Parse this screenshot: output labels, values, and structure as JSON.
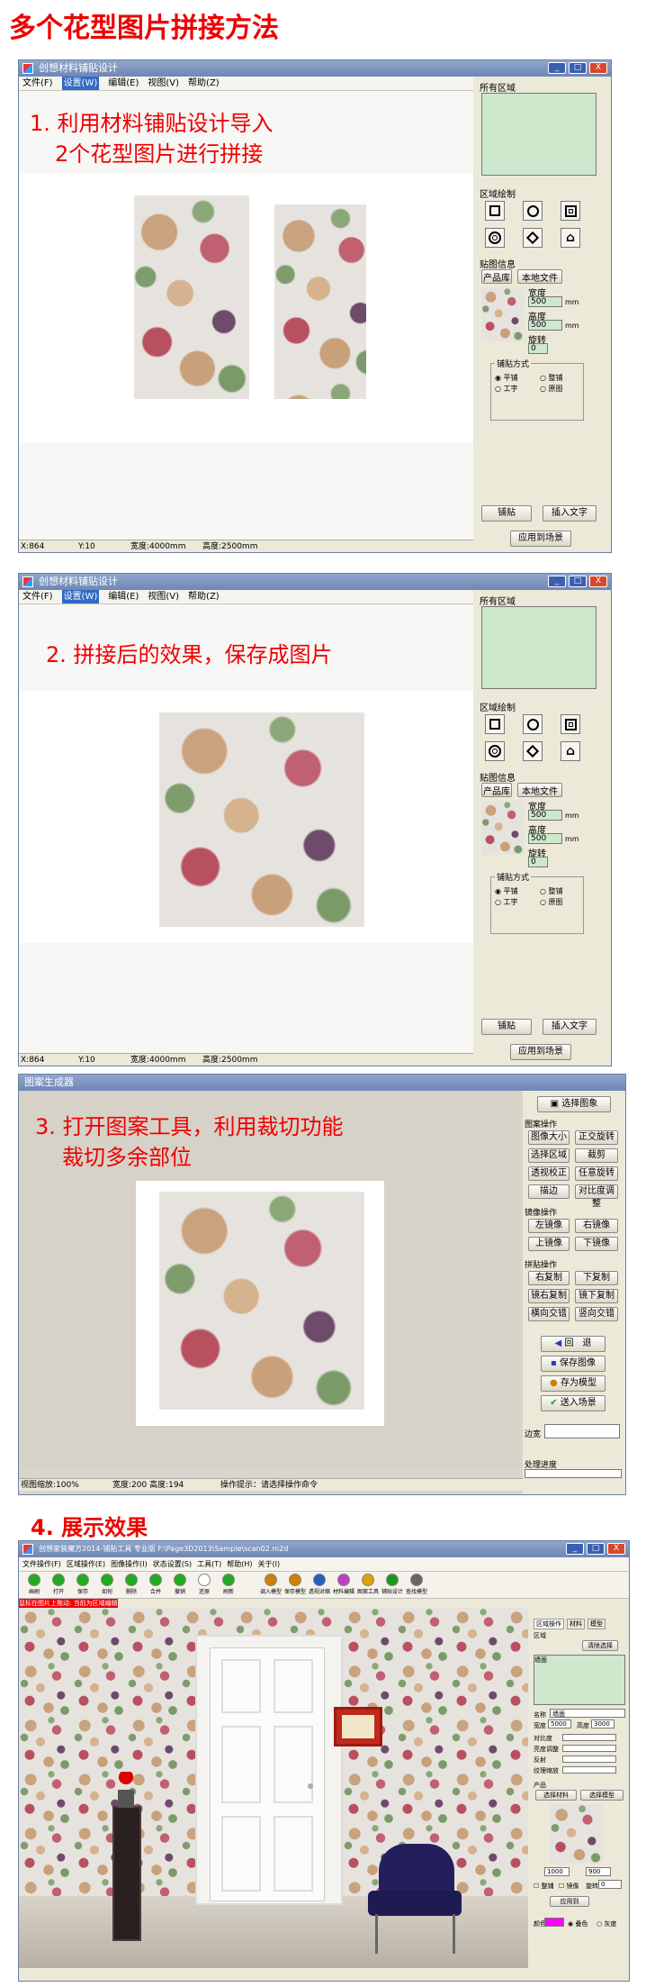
{
  "page_title": "多个花型图片拼接方法",
  "shared": {
    "app_title": "创想材料铺贴设计",
    "menu": [
      "文件(F)",
      "设置(W)",
      "编辑(E)",
      "视图(V)",
      "帮助(Z)"
    ],
    "panel": {
      "all_regions": "所有区域",
      "region_draw": "区域绘制",
      "tile_info": "贴图信息",
      "product_lib": "产品库",
      "local_file": "本地文件",
      "width_label": "宽度",
      "height_label": "高度",
      "rotate_label": "旋转",
      "width_value": "500",
      "height_value": "500",
      "unit": "mm",
      "rotate_value": "0",
      "tile_mode": "铺贴方式",
      "modes": [
        "平铺",
        "整铺",
        "工字",
        "原图"
      ],
      "tile_btn": "铺贴",
      "insert_text_btn": "插入文字",
      "apply_btn": "应用到场景"
    },
    "status": {
      "x": "X:864",
      "y": "Y:10",
      "w": "宽度:4000mm",
      "h": "高度:2500mm"
    },
    "close": "X"
  },
  "step1": {
    "caption_line1": "1. 利用材料铺贴设计导入",
    "caption_line2": "2个花型图片进行拼接"
  },
  "step2": {
    "caption": "2. 拼接后的效果，保存成图片"
  },
  "step3": {
    "window_title": "图案生成器",
    "caption_line1": "3. 打开图案工具，利用裁切功能",
    "caption_line2": "裁切多余部位",
    "select_image": "选择图象",
    "pattern_ops": "图案操作",
    "ops": [
      "图像大小",
      "正交旋转",
      "选择区域",
      "裁剪",
      "透视校正",
      "任意旋转",
      "描边",
      "对比度调整"
    ],
    "mirror_ops": "镜像操作",
    "mirror": [
      "左镜像",
      "右镜像",
      "上镜像",
      "下镜像"
    ],
    "tile_ops": "拼贴操作",
    "tile": [
      "右复制",
      "下复制",
      "镜右复制",
      "镜下复制",
      "横向交错",
      "竖向交错"
    ],
    "back": "回　退",
    "save_image": "保存图像",
    "save_model": "存为模型",
    "insert_scene": "送入场景",
    "edge": "边宽",
    "process": "处理进度",
    "status_zoom": "视图缩放:100%",
    "status_size": "宽度:200 高度:194",
    "status_tip": "操作提示：请选择操作命令"
  },
  "step4": {
    "caption": "4. 展示效果",
    "window_title": "创想家装魔方2014-铺贴工具 专业版 F:\\Page3D2013\\Sample\\scan02.m2d",
    "menu": [
      "文件操作(F)",
      "区域操作(E)",
      "图像操作(I)",
      "状态设置(S)",
      "工具(T)",
      "帮助(H)",
      "关于(I)"
    ],
    "toolbar": [
      "画刷",
      "打开",
      "保存",
      "如何",
      "删除",
      "合并",
      "撤销",
      "还原",
      "刷新",
      "调入模型",
      "保存模型",
      "透视对缩",
      "材料编辑",
      "图案工具",
      "铺贴设计",
      "查找模型"
    ],
    "warn_text": "鼠标在图片上拖动:  当前为区域编辑状态",
    "right": {
      "tabs": [
        "区域操作",
        "材料",
        "模型"
      ],
      "region": "区域",
      "clear_btn": "清除选择",
      "list_item": "墙面",
      "name_label": "名称",
      "name_value": "墙面",
      "width_label": "宽度",
      "width_value": "5000",
      "height_label": "高度",
      "height_value": "3000",
      "contrast": "对比度",
      "brightness": "亮度调整",
      "transparency": "反射",
      "distance": "纹理缩放",
      "product": "产品",
      "select_mat": "选择材料",
      "select_model": "选择模型",
      "w2": "1000",
      "h2": "900",
      "tile": "整铺",
      "mirror": "镜像",
      "rotate": "旋转",
      "rotate_value": "0",
      "apply": "应用到",
      "color": "颜色",
      "blend": "叠色",
      "gray": "灰度"
    }
  }
}
